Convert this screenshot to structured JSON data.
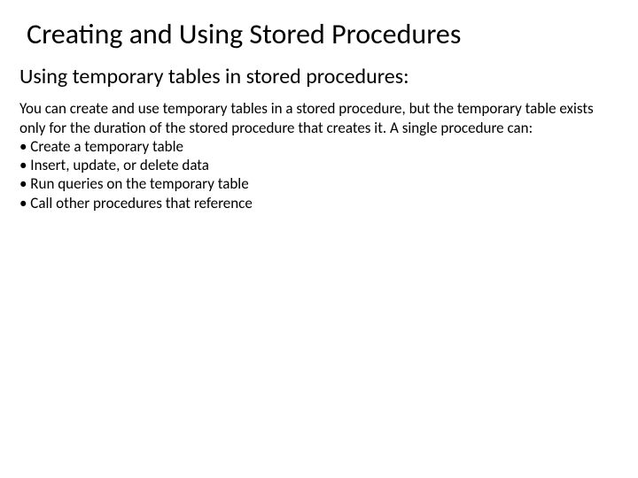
{
  "title": "Creating and Using Stored Procedures",
  "subheading": "Using temporary tables in stored procedures:",
  "intro": "You can create and use temporary tables in a stored procedure, but the temporary table exists only for the duration of the stored procedure that creates it. A single procedure can:",
  "bullets": [
    "• Create a temporary table",
    "• Insert, update, or delete data",
    "• Run queries on the temporary table",
    "• Call other procedures that reference"
  ]
}
